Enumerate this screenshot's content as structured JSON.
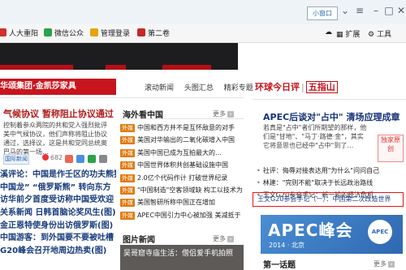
{
  "browser": {
    "mini_window_label": "小窗口",
    "toolbar_right": [
      "扩展",
      "工具"
    ],
    "bookmarks": [
      {
        "label": "人大重阳",
        "color": "#d0312d"
      },
      {
        "label": "微信公众",
        "color": "#2aa34a"
      },
      {
        "label": "管理登录",
        "color": "#e5a50a"
      },
      {
        "label": "第二卷",
        "color": "#c62828"
      }
    ]
  },
  "left": {
    "ad_label": "华颂集团·金凯莎家具",
    "headline": "气候协议 暂称阻止协议通过",
    "summary": "控制着参众两院的共和党人强烈批评美中气候协议，他们声称将阻止协议通过，选择议，这是共和党同总统奥巴马的第一场…",
    "source_tag": "国际新闻",
    "likes": "682",
    "items": [
      "溪评论：中国是作壬区的功夫熊猫",
      "中国龙” “俄罗斯熊” 转向东方",
      "访华前夕首度受访称中国受欢迎",
      "关系新闻 日韩首脑论奖风生(图)",
      "金正恩特使身份出访俄罗斯(图)",
      "中国游客：到外国要不要被吐槽",
      "G20峰会召开地周边热卖(图)"
    ]
  },
  "middle": {
    "tabs": [
      "滚动新闻",
      "头图汇总",
      "精彩专题"
    ],
    "section_title": "海外看中国",
    "more_label": "更多",
    "items": [
      {
        "tag": "外媒",
        "text": "中国和西方并不是互怀敌意的对手"
      },
      {
        "tag": "外媒",
        "text": "美国对华输出的二氧化碳增入中国"
      },
      {
        "tag": "外媒",
        "text": "美国中国已成为互拍最大的…"
      },
      {
        "tag": "外媒",
        "text": "中国世界体积共创基础设施中国"
      },
      {
        "tag": "外媒",
        "text": "2.0亿个代码作计 打破世界纪录"
      },
      {
        "tag": "外媒",
        "text": "\"中国制造\"空客领域缺 构工以技术为"
      },
      {
        "tag": "外媒",
        "text": "美国智研所称中国正在增加 "
      },
      {
        "tag": "外媒",
        "text": "APEC中国引力中心被加强 美减抵于"
      }
    ],
    "pic_section_title": "图片新闻",
    "pic_caption": "吴哥窟寺庙生活：僧侣爱手机拍照"
  },
  "right": {
    "logo_text": "环球今日评",
    "logo_paper": "五指山",
    "headline": "APEC后谈对\"占中\" 清场应理成章",
    "summary": "若真是\"占中\"者们所期望的那样，他们是\"甘地\"、\"马丁·路德·金\"，其实它将意思也已经中\"占中\"到了…",
    "seal_text": "独家原创",
    "items": [
      "社评：侮辱对接表达用\"为什么\"问问自己",
      "林建：\"完则不能\"取决于长远政治路线",
      "王文G20参会手记：新一轮的经济危机"
    ],
    "highlight": "王文G20参会手记（一）：中国第二次改造世界",
    "ad_big": "APEC峰会",
    "ad_small": "2014 · 北京",
    "ad_logo": "APEC",
    "bottom_title": "第一话题",
    "more_label": "更多"
  },
  "colors": {
    "brand_red": "#c8151d",
    "tag_orange": "#e07a10",
    "link_blue": "#1a3d7c",
    "highlight_border": "#ee1111"
  }
}
